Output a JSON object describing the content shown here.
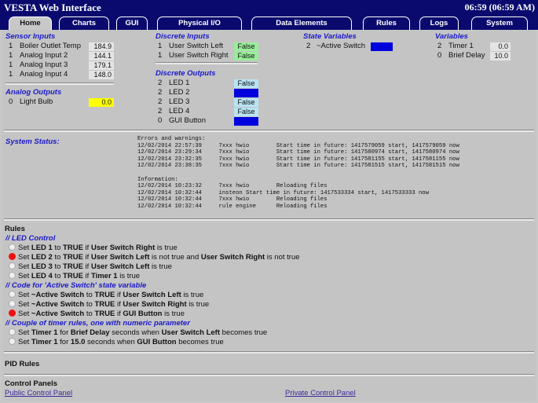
{
  "app": {
    "title": "VESTA Web Interface",
    "clock": "06:59 (06:59 AM)"
  },
  "tabs": [
    "Home",
    "Charts",
    "GUI",
    "Physical I/O",
    "Data Elements",
    "Rules",
    "Logs",
    "System"
  ],
  "sensor_inputs": {
    "title": "Sensor Inputs",
    "rows": [
      {
        "num": "1",
        "label": "Boiler Outlet Temp",
        "value": "184.9"
      },
      {
        "num": "1",
        "label": "Analog Input 2",
        "value": "144.1"
      },
      {
        "num": "1",
        "label": "Analog Input 3",
        "value": "179.1"
      },
      {
        "num": "1",
        "label": "Analog Input 4",
        "value": "148.0"
      }
    ]
  },
  "analog_outputs": {
    "title": "Analog Outputs",
    "rows": [
      {
        "num": "0",
        "label": "Light Bulb",
        "value": "0.0"
      }
    ]
  },
  "discrete_inputs": {
    "title": "Discrete Inputs",
    "rows": [
      {
        "num": "1",
        "label": "User Switch Left",
        "value": "False"
      },
      {
        "num": "1",
        "label": "User Switch Right",
        "value": "False"
      }
    ]
  },
  "discrete_outputs": {
    "title": "Discrete Outputs",
    "rows": [
      {
        "num": "2",
        "label": "LED 1",
        "value": "False"
      },
      {
        "num": "2",
        "label": "LED 2",
        "value": "True"
      },
      {
        "num": "2",
        "label": "LED 3",
        "value": "False"
      },
      {
        "num": "2",
        "label": "LED 4",
        "value": "False"
      },
      {
        "num": "0",
        "label": "GUI Button",
        "value": "True"
      }
    ]
  },
  "state_variables": {
    "title": "State Variables",
    "rows": [
      {
        "num": "2",
        "label": "~Active Switch",
        "value": "True"
      }
    ]
  },
  "variables": {
    "title": "Variables",
    "rows": [
      {
        "num": "2",
        "label": "Timer 1",
        "value": "0.0"
      },
      {
        "num": "0",
        "label": "Brief Delay",
        "value": "10.0"
      }
    ]
  },
  "system_status": {
    "label": "System Status:",
    "errors_heading": "Errors and warnings:",
    "errors": [
      "12/02/2014 22:57:39     7xxx hwio        Start time in future: 1417579059 start, 1417579059 now",
      "12/02/2014 23:29:34     7xxx hwio        Start time in future: 1417580974 start, 1417580974 now",
      "12/02/2014 23:32:35     7xxx hwio        Start time in future: 1417581155 start, 1417581155 now",
      "12/02/2014 23:38:35     7xxx hwio        Start time in future: 1417581515 start, 1417581515 now"
    ],
    "info_heading": "Information:",
    "info": [
      "12/02/2014 10:23:32     7xxx hwio        Reloading files",
      "12/02/2014 10:32:44     insteon Start time in future: 1417533334 start, 1417533333 now",
      "12/02/2014 10:32:44     7xxx hwio        Reloading files",
      "12/02/2014 10:32:44     rule engine      Reloading files"
    ]
  },
  "rules": {
    "title": "Rules",
    "items": [
      {
        "type": "comment",
        "text": "// LED Control"
      },
      {
        "type": "rule",
        "dot": "grey",
        "parts": [
          [
            "Set ",
            0
          ],
          [
            "LED 1",
            1
          ],
          [
            " to ",
            0
          ],
          [
            "TRUE",
            1
          ],
          [
            " if ",
            0
          ],
          [
            "User Switch Right",
            1
          ],
          [
            " is true",
            0
          ]
        ]
      },
      {
        "type": "rule",
        "dot": "red",
        "parts": [
          [
            "Set ",
            0
          ],
          [
            "LED 2",
            1
          ],
          [
            " to ",
            0
          ],
          [
            "TRUE",
            1
          ],
          [
            " if ",
            0
          ],
          [
            "User Switch Left",
            1
          ],
          [
            " is not true and ",
            0
          ],
          [
            "User Switch Right",
            1
          ],
          [
            " is not true",
            0
          ]
        ]
      },
      {
        "type": "rule",
        "dot": "grey",
        "parts": [
          [
            "Set ",
            0
          ],
          [
            "LED 3",
            1
          ],
          [
            " to ",
            0
          ],
          [
            "TRUE",
            1
          ],
          [
            " if ",
            0
          ],
          [
            "User Switch Left",
            1
          ],
          [
            " is true",
            0
          ]
        ]
      },
      {
        "type": "rule",
        "dot": "grey",
        "parts": [
          [
            "Set ",
            0
          ],
          [
            "LED 4",
            1
          ],
          [
            " to ",
            0
          ],
          [
            "TRUE",
            1
          ],
          [
            " if ",
            0
          ],
          [
            "Timer 1",
            1
          ],
          [
            " is true",
            0
          ]
        ]
      },
      {
        "type": "comment",
        "text": "// Code for 'Active Switch' state variable"
      },
      {
        "type": "rule",
        "dot": "grey",
        "parts": [
          [
            "Set ",
            0
          ],
          [
            "~Active Switch",
            1
          ],
          [
            " to ",
            0
          ],
          [
            "TRUE",
            1
          ],
          [
            " if ",
            0
          ],
          [
            "User Switch Left",
            1
          ],
          [
            " is true",
            0
          ]
        ]
      },
      {
        "type": "rule",
        "dot": "grey",
        "parts": [
          [
            "Set ",
            0
          ],
          [
            "~Active Switch",
            1
          ],
          [
            " to ",
            0
          ],
          [
            "TRUE",
            1
          ],
          [
            " if ",
            0
          ],
          [
            "User Switch Right",
            1
          ],
          [
            " is true",
            0
          ]
        ]
      },
      {
        "type": "rule",
        "dot": "red",
        "parts": [
          [
            "Set ",
            0
          ],
          [
            "~Active Switch",
            1
          ],
          [
            " to ",
            0
          ],
          [
            "TRUE",
            1
          ],
          [
            " if ",
            0
          ],
          [
            "GUI Button",
            1
          ],
          [
            " is true",
            0
          ]
        ]
      },
      {
        "type": "comment",
        "text": "// Couple of timer rules, one with numeric parameter"
      },
      {
        "type": "rule",
        "dot": "grey",
        "parts": [
          [
            "Set ",
            0
          ],
          [
            "Timer 1",
            1
          ],
          [
            " for ",
            0
          ],
          [
            "Brief Delay",
            1
          ],
          [
            " seconds when ",
            0
          ],
          [
            "User Switch Left",
            1
          ],
          [
            " becomes true",
            0
          ]
        ]
      },
      {
        "type": "rule",
        "dot": "grey",
        "parts": [
          [
            "Set ",
            0
          ],
          [
            "Timer 1",
            1
          ],
          [
            " for ",
            0
          ],
          [
            "15.0",
            1
          ],
          [
            " seconds when ",
            0
          ],
          [
            "GUI Button",
            1
          ],
          [
            " becomes true",
            0
          ]
        ]
      }
    ]
  },
  "pid_rules": {
    "title": "PID Rules"
  },
  "control_panels": {
    "title": "Control Panels",
    "public_link": "Public Control Panel",
    "private_link": "Private Control Panel"
  },
  "colors": {
    "header_bg": "#0a0a6e",
    "section_title": "#1a1acc",
    "false_input": "#99ee99",
    "false_output": "#b8e4f4",
    "true_value": "#0000dd",
    "analog_output_bg": "#ffff00",
    "active_rule_dot": "#ee1111"
  }
}
